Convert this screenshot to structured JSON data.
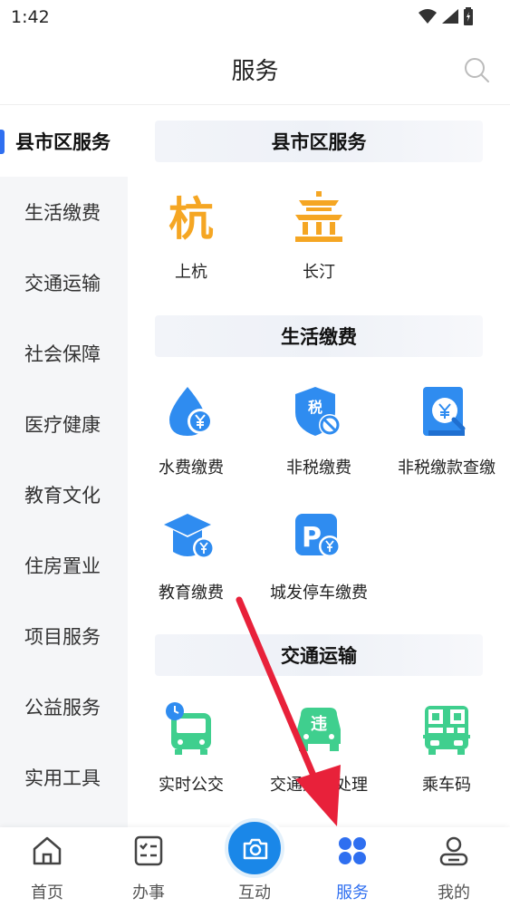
{
  "status_bar": {
    "time": "1:42"
  },
  "header": {
    "title": "服务"
  },
  "sidebar": {
    "items": [
      {
        "label": "县市区服务"
      },
      {
        "label": "生活缴费"
      },
      {
        "label": "交通运输"
      },
      {
        "label": "社会保障"
      },
      {
        "label": "医疗健康"
      },
      {
        "label": "教育文化"
      },
      {
        "label": "住房置业"
      },
      {
        "label": "项目服务"
      },
      {
        "label": "公益服务"
      },
      {
        "label": "实用工具"
      }
    ]
  },
  "sections": [
    {
      "title": "县市区服务",
      "items": [
        {
          "label": "上杭"
        },
        {
          "label": "长汀"
        }
      ]
    },
    {
      "title": "生活缴费",
      "items": [
        {
          "label": "水费缴费"
        },
        {
          "label": "非税缴费"
        },
        {
          "label": "非税缴款查缴"
        },
        {
          "label": "教育缴费"
        },
        {
          "label": "城发停车缴费"
        }
      ]
    },
    {
      "title": "交通运输",
      "items": [
        {
          "label": "实时公交"
        },
        {
          "label": "交通违法处理"
        },
        {
          "label": "乘车码"
        }
      ]
    }
  ],
  "icon_text": {
    "hang": "杭",
    "tax": "税",
    "violation": "违"
  },
  "bottom_nav": {
    "items": [
      {
        "label": "首页"
      },
      {
        "label": "办事"
      },
      {
        "label": "互动"
      },
      {
        "label": "服务"
      },
      {
        "label": "我的"
      }
    ]
  },
  "colors": {
    "accent": "#2f6ff0",
    "orange": "#f5a623",
    "blue_icon": "#2f8cf0",
    "green_icon": "#3fcf8e",
    "arrow": "#e8213a"
  }
}
